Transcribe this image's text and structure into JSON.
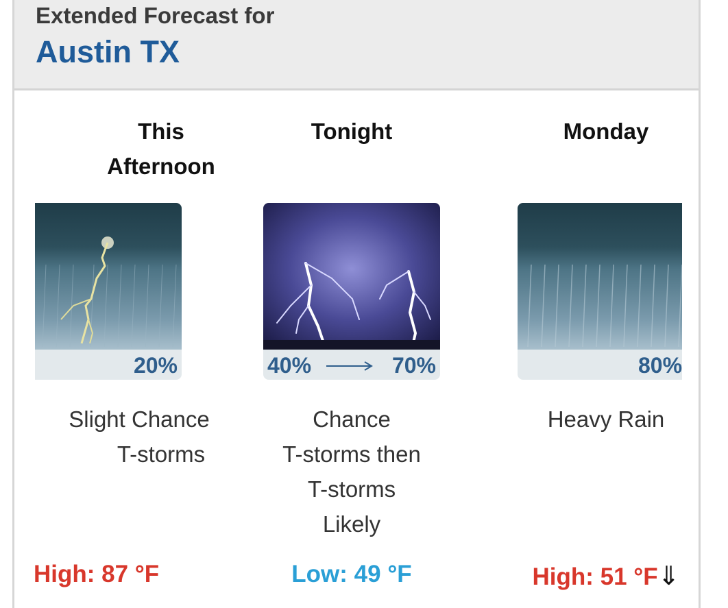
{
  "header": {
    "subtitle": "Extended Forecast for",
    "location": "Austin TX"
  },
  "periods": [
    {
      "name_line1": "This",
      "name_line2": "Afternoon",
      "image_icon": "thunderstorm-icon",
      "precip_label": "20%",
      "precip_chance": 20,
      "desc_line1": "Slight Chance",
      "desc_line2": "T-storms",
      "temp_text": "High: 87 °F",
      "temp_color": "#d8372b"
    },
    {
      "name_line1": "Tonight",
      "image_icon": "lightning-icon",
      "precip_from": "40%",
      "precip_to": "70%",
      "desc_line1": "Chance",
      "desc_line2": "T-storms then",
      "desc_line3": "T-storms",
      "desc_line4": "Likely",
      "temp_text": "Low: 49 °F",
      "temp_color": "#2a9fd6"
    },
    {
      "name_line1": "Monday",
      "image_icon": "heavy-rain-icon",
      "precip_label": "80%",
      "precip_chance": 80,
      "desc_line1": "Heavy Rain",
      "temp_text": "High: 51 °F",
      "temp_arrow": "⇓",
      "temp_color": "#d8372b"
    }
  ],
  "colors": {
    "header_bg": "#ececec",
    "location": "#1f5b99",
    "high": "#d8372b",
    "low": "#2a9fd6"
  }
}
